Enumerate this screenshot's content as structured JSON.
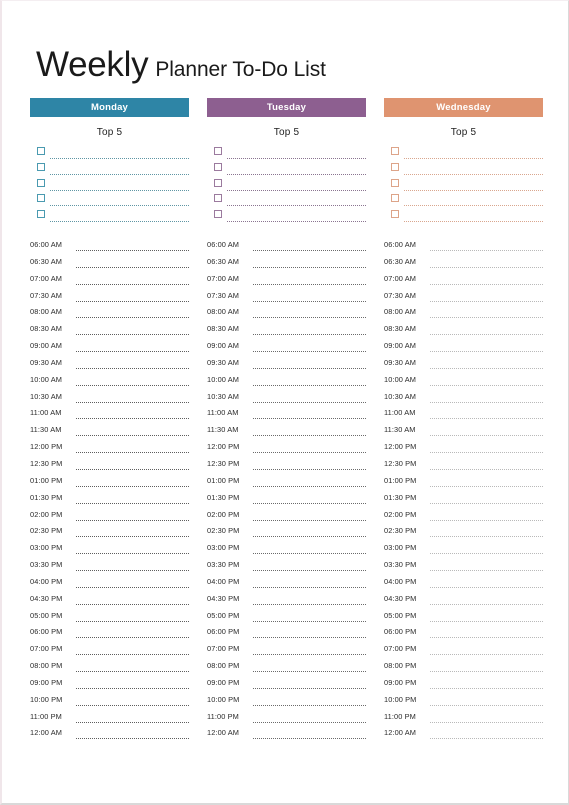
{
  "document": {
    "title_main": "Weekly",
    "title_sub": "Planner To-Do List"
  },
  "columns": [
    {
      "day": "Monday",
      "top5_label": "Top 5",
      "accent": "#2e85a6",
      "checkbox_border": "#4a9ab0",
      "checkbox_count": 5
    },
    {
      "day": "Tuesday",
      "top5_label": "Top 5",
      "accent": "#8d5f90",
      "checkbox_border": "#9b7a9e",
      "checkbox_count": 5
    },
    {
      "day": "Wednesday",
      "top5_label": "Top 5",
      "accent": "#df9470",
      "checkbox_border": "#dda489",
      "checkbox_count": 5
    }
  ],
  "time_slots": [
    "06:00 AM",
    "06:30 AM",
    "07:00 AM",
    "07:30 AM",
    "08:00 AM",
    "08:30 AM",
    "09:00 AM",
    "09:30 AM",
    "10:00 AM",
    "10:30 AM",
    "11:00 AM",
    "11:30 AM",
    "12:00 PM",
    "12:30 PM",
    "01:00 PM",
    "01:30 PM",
    "02:00 PM",
    "02:30 PM",
    "03:00 PM",
    "03:30 PM",
    "04:00 PM",
    "04:30 PM",
    "05:00 PM",
    "06:00 PM",
    "07:00 PM",
    "08:00 PM",
    "09:00 PM",
    "10:00 PM",
    "11:00 PM",
    "12:00 AM"
  ]
}
